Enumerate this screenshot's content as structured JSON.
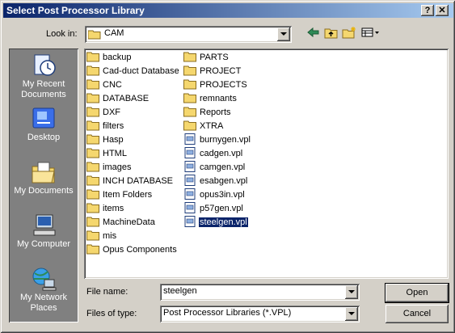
{
  "window": {
    "title": "Select Post Processor Library",
    "help_label": "?",
    "close_label": "✕"
  },
  "lookin": {
    "label": "Look in:",
    "value": "CAM"
  },
  "toolbar": {
    "back_icon": "back-arrow-icon",
    "up_icon": "up-folder-icon",
    "new_folder_icon": "new-folder-icon",
    "view_icon": "view-menu-icon"
  },
  "places": [
    {
      "label": "My Recent Documents",
      "icon": "recent-documents-icon"
    },
    {
      "label": "Desktop",
      "icon": "desktop-icon"
    },
    {
      "label": "My Documents",
      "icon": "my-documents-icon"
    },
    {
      "label": "My Computer",
      "icon": "my-computer-icon"
    },
    {
      "label": "My Network Places",
      "icon": "network-places-icon"
    }
  ],
  "files": {
    "col1": [
      "backup",
      "Cad-duct Database",
      "CNC",
      "DATABASE",
      "DXF",
      "filters",
      "Hasp",
      "HTML",
      "images",
      "INCH DATABASE",
      "Item Folders",
      "items",
      "MachineData",
      "mis",
      "Opus Components"
    ],
    "col2_folders": [
      "PARTS",
      "PROJECT",
      "PROJECTS",
      "remnants",
      "Reports",
      "XTRA"
    ],
    "col2_files": [
      "burnygen.vpl",
      "cadgen.vpl",
      "camgen.vpl",
      "esabgen.vpl",
      "opus3in.vpl",
      "p57gen.vpl",
      "steelgen.vpl"
    ],
    "selected": "steelgen.vpl"
  },
  "filename": {
    "label": "File name:",
    "value": "steelgen"
  },
  "filetype": {
    "label": "Files of type:",
    "value": "Post Processor Libraries (*.VPL)"
  },
  "buttons": {
    "open": "Open",
    "cancel": "Cancel"
  },
  "colors": {
    "titlebar_start": "#0a246a",
    "titlebar_end": "#a6caf0",
    "selection": "#0a246a",
    "folder": "#f5d76e"
  }
}
